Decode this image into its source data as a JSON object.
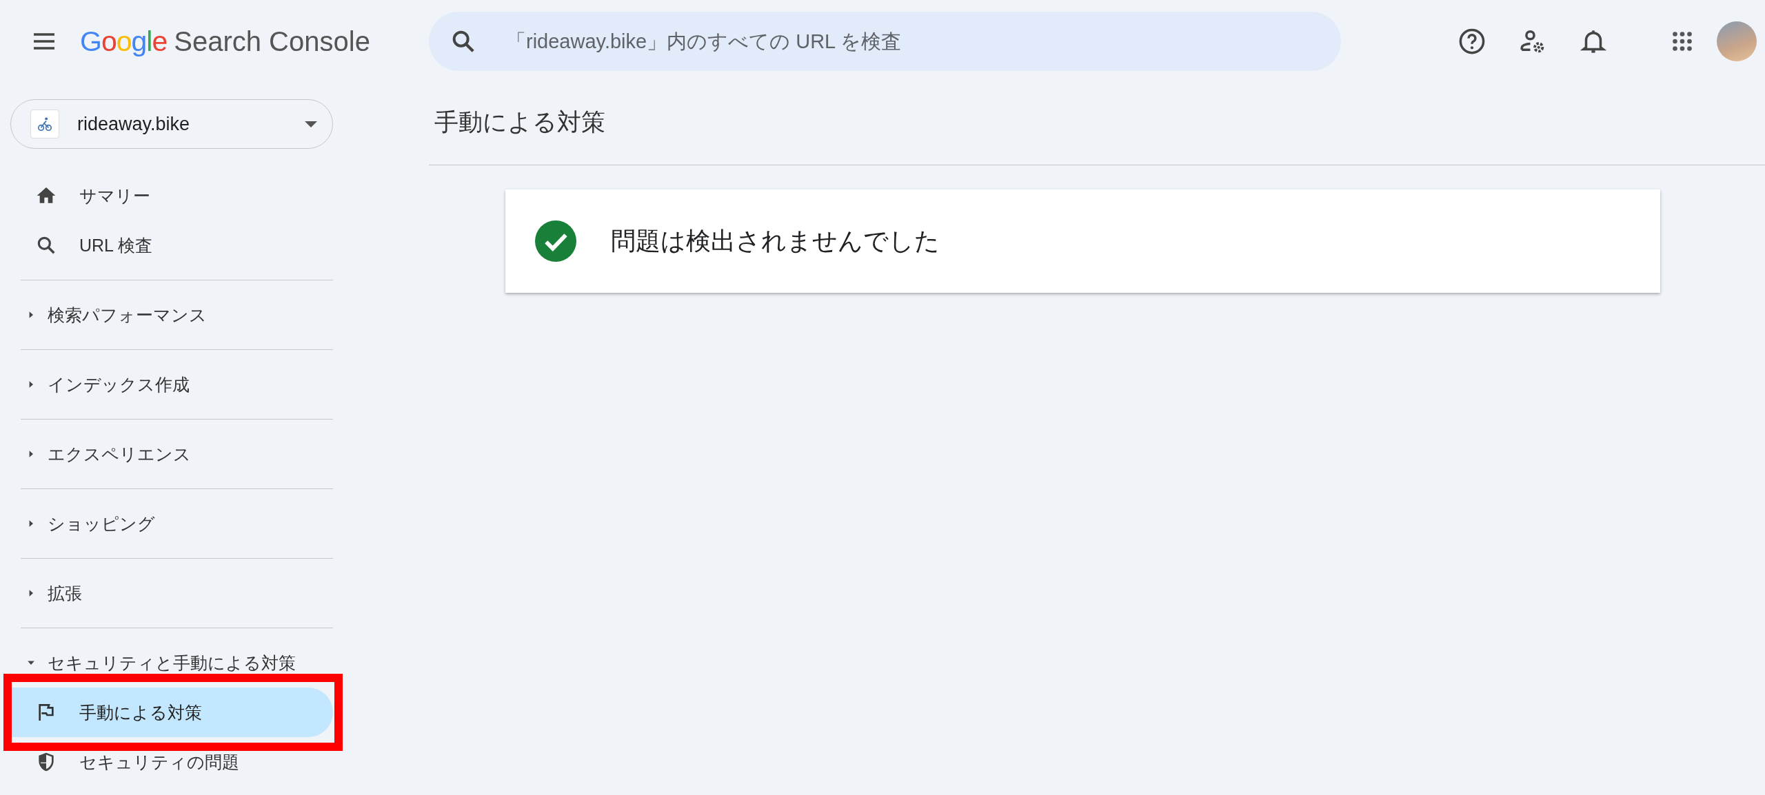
{
  "header": {
    "logo_word": "Google",
    "product": "Search Console",
    "search": {
      "placeholder": "「rideaway.bike」内のすべての URL を検査"
    }
  },
  "property": {
    "name": "rideaway.bike"
  },
  "sidebar": {
    "items": [
      {
        "kind": "link",
        "label": "サマリー",
        "selected": false,
        "highlighted": false
      },
      {
        "kind": "link",
        "label": "URL 検査",
        "selected": false,
        "highlighted": false
      },
      {
        "kind": "section",
        "label": "検索パフォーマンス",
        "expanded": false
      },
      {
        "kind": "section",
        "label": "インデックス作成",
        "expanded": false
      },
      {
        "kind": "section",
        "label": "エクスペリエンス",
        "expanded": false
      },
      {
        "kind": "section",
        "label": "ショッピング",
        "expanded": false
      },
      {
        "kind": "section",
        "label": "拡張",
        "expanded": false
      },
      {
        "kind": "section",
        "label": "セキュリティと手動による対策",
        "expanded": true,
        "children": [
          {
            "label": "手動による対策",
            "selected": true,
            "highlighted": true
          },
          {
            "label": "セキュリティの問題",
            "selected": false,
            "highlighted": false
          }
        ]
      }
    ]
  },
  "page": {
    "title": "手動による対策",
    "status": {
      "kind": "ok",
      "message": "問題は検出されませんでした"
    }
  }
}
